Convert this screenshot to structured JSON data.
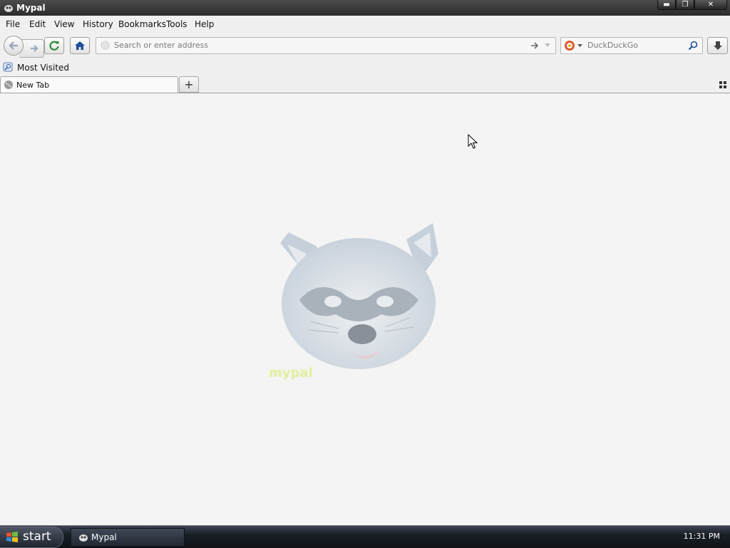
{
  "window": {
    "title": "Mypal",
    "controls": {
      "minimize": "minimize",
      "restore": "restore",
      "close": "close"
    }
  },
  "menu": {
    "items": [
      "File",
      "Edit",
      "View",
      "History",
      "Bookmarks",
      "Tools",
      "Help"
    ]
  },
  "navbar": {
    "url_placeholder": "Search or enter address",
    "search_engine_placeholder": "DuckDuckGo"
  },
  "bookmarks": {
    "items": [
      {
        "label": "Most Visited",
        "icon": "most-visited-icon"
      }
    ]
  },
  "tabs": [
    {
      "label": "New Tab",
      "icon": "globe-icon",
      "active": true
    }
  ],
  "newtab": {
    "symbol": "+"
  },
  "content": {
    "logo_text": "mypal"
  },
  "taskbar": {
    "start_label": "start",
    "items": [
      {
        "label": "Mypal",
        "icon": "mypal-icon"
      }
    ],
    "clock": "11:31 PM"
  },
  "colors": {
    "titlebar": "#2b2b2b",
    "content_bg": "#f4f4f4",
    "taskbar": "#1a1f26",
    "home_icon": "#1e4f9a",
    "reload_icon": "#2e8b3a"
  }
}
